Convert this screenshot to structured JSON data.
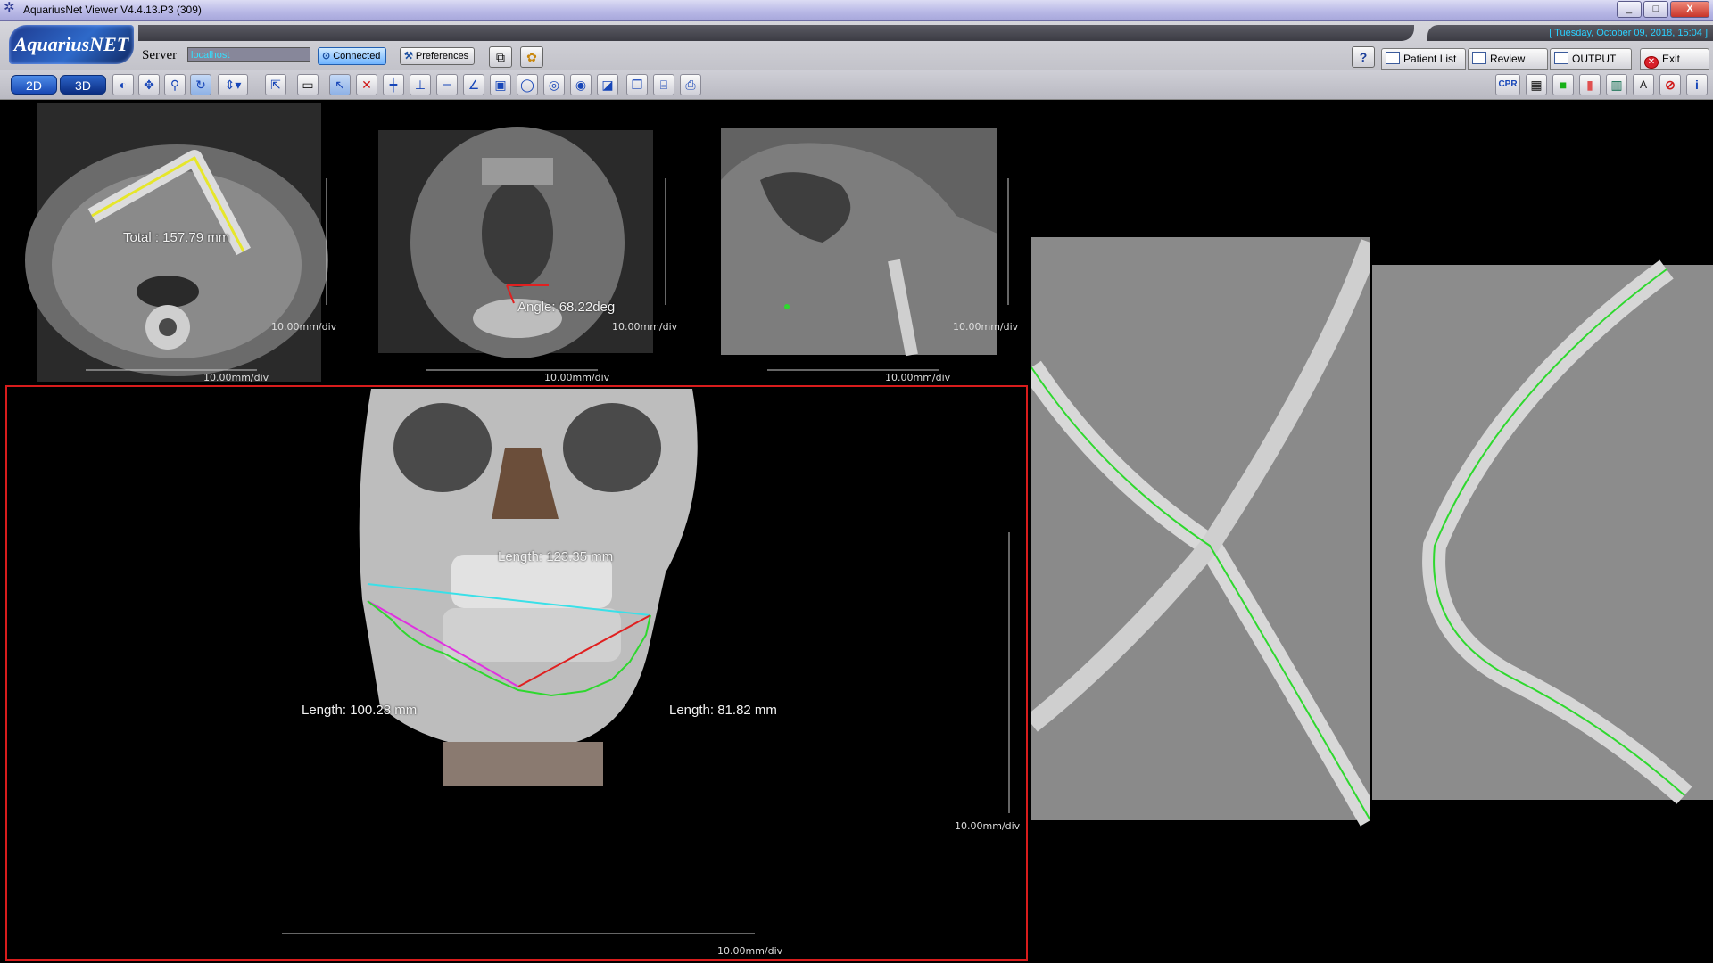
{
  "window": {
    "title": "AquariusNet Viewer   V4.4.13.P3 (309)",
    "controls": [
      "_",
      "□",
      "X"
    ]
  },
  "header": {
    "logo": "AquariusNET",
    "server_label": "Server",
    "server_value": "localhost",
    "connected_label": "Connected",
    "preferences_label": "Preferences",
    "help_label": "?",
    "datetime": "[ Tuesday, October 09, 2018, 15:04 ]",
    "tabs": {
      "patient_list": "Patient List",
      "review": "Review",
      "output": "OUTPUT",
      "exit": "Exit"
    }
  },
  "toolbar": {
    "mode_2d": "2D",
    "mode_3d": "3D",
    "tools": [
      "contrast",
      "pan",
      "zoom",
      "rotate",
      "scroll",
      "select",
      "ruler",
      "arrow",
      "delete",
      "line",
      "distance",
      "ortho",
      "angle",
      "rect-roi",
      "ellipse-roi",
      "sphere",
      "eye",
      "histogram",
      "cube",
      "cylinder",
      "export"
    ],
    "right_tools": [
      "CPR",
      "layout",
      "green",
      "color",
      "grid",
      "text",
      "no-annotation",
      "info"
    ],
    "cpr_label": "CPR"
  },
  "colors": {
    "measure_yellow": "#e6e62a",
    "measure_red": "#e02020",
    "measure_cyan": "#3ae0e8",
    "measure_magenta": "#e030e0",
    "curve_green": "#2ed82e",
    "selected_border": "#d81c1c"
  },
  "views": {
    "axial": {
      "measurement": "Total : 157.79 mm",
      "scale_right": "10.00mm/div",
      "scale_bottom": "10.00mm/div"
    },
    "coronal": {
      "measurement": "Angle: 68.22deg",
      "scale_right": "10.00mm/div",
      "scale_bottom": "10.00mm/div"
    },
    "sagittal": {
      "scale_right": "10.00mm/div",
      "scale_bottom": "10.00mm/div"
    },
    "volume3d": {
      "length_top": "Length: 123.35 mm",
      "length_left": "Length: 100.28 mm",
      "length_right": "Length: 81.82 mm",
      "scale_right": "10.00mm/div",
      "scale_bottom": "10.00mm/div"
    }
  }
}
